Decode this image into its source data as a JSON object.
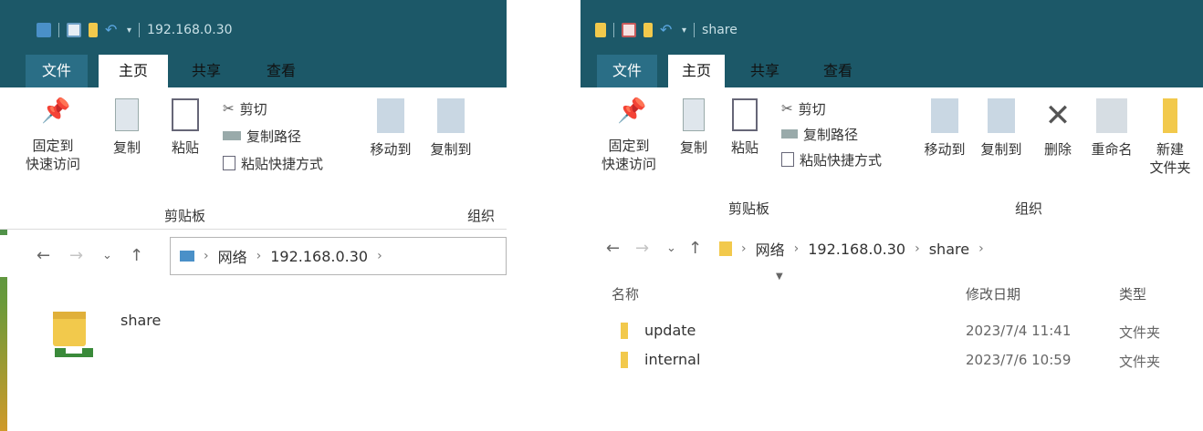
{
  "left": {
    "window_title": "192.168.0.30",
    "tabs": [
      "文件",
      "主页",
      "共享",
      "查看"
    ],
    "ribbon": {
      "pin_line1": "固定到",
      "pin_line2": "快速访问",
      "copy": "复制",
      "paste": "粘贴",
      "cut": "剪切",
      "copy_path": "复制路径",
      "paste_shortcut": "粘贴快捷方式",
      "move_to": "移动到",
      "copy_to": "复制到",
      "group_clipboard": "剪贴板",
      "group_organize": "组织"
    },
    "breadcrumb": [
      "网络",
      "192.168.0.30"
    ],
    "items": [
      {
        "name": "share",
        "icon": "network-share-icon"
      }
    ]
  },
  "right": {
    "window_title": "share",
    "tabs": [
      "文件",
      "主页",
      "共享",
      "查看"
    ],
    "ribbon": {
      "pin_line1": "固定到",
      "pin_line2": "快速访问",
      "copy": "复制",
      "paste": "粘贴",
      "cut": "剪切",
      "copy_path": "复制路径",
      "paste_shortcut": "粘贴快捷方式",
      "move_to": "移动到",
      "copy_to": "复制到",
      "delete": "删除",
      "rename": "重命名",
      "new_folder_line1": "新建",
      "new_folder_line2": "文件夹",
      "group_clipboard": "剪贴板",
      "group_organize": "组织"
    },
    "breadcrumb": [
      "网络",
      "192.168.0.30",
      "share"
    ],
    "columns": [
      "名称",
      "修改日期",
      "类型"
    ],
    "rows": [
      {
        "name": "update",
        "date": "2023/7/4 11:41",
        "type": "文件夹"
      },
      {
        "name": "internal",
        "date": "2023/7/6 10:59",
        "type": "文件夹"
      }
    ]
  },
  "colors": {
    "titlebar": "#1c5868",
    "file_tab": "#2a6e86",
    "folder": "#f2c94c"
  }
}
